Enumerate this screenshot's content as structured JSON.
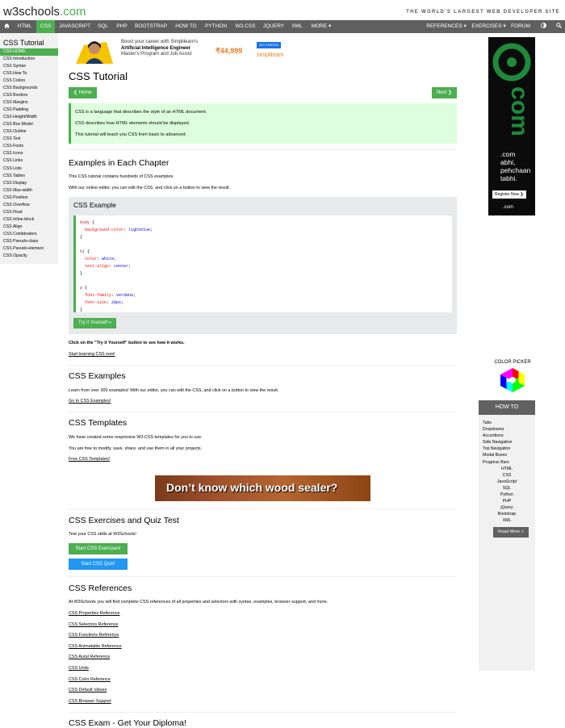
{
  "header": {
    "logo_text": "w3schools",
    "logo_suffix": ".com",
    "tagline": "THE WORLD'S LARGEST WEB DEVELOPER SITE"
  },
  "nav": {
    "items": [
      "HTML",
      "CSS",
      "JAVASCRIPT",
      "SQL",
      "PHP",
      "BOOTSTRAP",
      "HOW TO",
      "PYTHON",
      "W3.CSS",
      "JQUERY",
      "XML",
      "MORE ▾"
    ],
    "active": "CSS",
    "right_items": [
      "REFERENCES ▾",
      "EXERCISES ▾",
      "FORUM"
    ]
  },
  "sidebar": {
    "title": "CSS Tutorial",
    "links": [
      "CSS HOME",
      "CSS Introduction",
      "CSS Syntax",
      "CSS How To",
      "CSS Colors",
      "CSS Backgrounds",
      "CSS Borders",
      "CSS Margins",
      "CSS Padding",
      "CSS Height/Width",
      "CSS Box Model",
      "CSS Outline",
      "CSS Text",
      "CSS Fonts",
      "CSS Icons",
      "CSS Links",
      "CSS Lists",
      "CSS Tables",
      "CSS Display",
      "CSS Max-width",
      "CSS Position",
      "CSS Overflow",
      "CSS Float",
      "CSS Inline-block",
      "CSS Align",
      "CSS Combinators",
      "CSS Pseudo-class",
      "CSS Pseudo-element",
      "CSS Opacity"
    ]
  },
  "top_ad": {
    "line1": "Boost your career with Simplilearn's",
    "line2": "Artificial Intelligence Engineer",
    "line3": "Master's Program and Job Assist",
    "price": "₹44,999",
    "cta": "GET STARTED",
    "brand": "simplilearn"
  },
  "main": {
    "title": "CSS Tutorial",
    "home_button": "❮ Home",
    "next_button": "Next ❯",
    "intro": [
      "CSS is a language that describes the style of an HTML document.",
      "CSS describes how HTML elements should be displayed.",
      "This tutorial will teach you CSS from basic to advanced."
    ],
    "examples_heading": "Examples in Each Chapter",
    "examples_p1": "This CSS tutorial contains hundreds of CSS examples.",
    "examples_p2": "With our online editor, you can edit the CSS, and click on a button to view the result.",
    "example_box_title": "CSS Example",
    "code_lines": [
      {
        "sel": "body",
        "text": " {"
      },
      {
        "prop": "  background-color",
        "val": " lightblue;"
      },
      {
        "brc": "}"
      },
      {
        "sel": "h1",
        "text": " {"
      },
      {
        "prop": "  color",
        "val": " white;"
      },
      {
        "prop": "  text-align",
        "val": " center;"
      },
      {
        "brc": "}"
      },
      {
        "sel": "p",
        "text": " {"
      },
      {
        "prop": "  font-family",
        "val": " verdana;"
      },
      {
        "prop": "  font-size",
        "val": " 20px;"
      },
      {
        "brc": "}"
      }
    ],
    "try_button": "Try it Yourself »",
    "click_note": "Click on the \"Try it Yourself\" button to see how it works.",
    "start_learning_link": "Start learning CSS now!",
    "css_examples_heading": "CSS Examples",
    "css_examples_p": "Learn from over 300 examples! With our editor, you can edit the CSS, and click on a button to view the result.",
    "css_examples_link": "Go to CSS Examples!",
    "templates_heading": "CSS Templates",
    "templates_p1": "We have created some responsive W3.CSS templates for you to use.",
    "templates_p2": "You are free to modify, save, share, and use them in all your projects.",
    "templates_link": "Free CSS Templates!",
    "wood_ad": "Don’t know which wood sealer?",
    "exercises_heading": "CSS Exercises and Quiz Test",
    "exercises_p": "Test your CSS skills at W3Schools!",
    "exercises_button": "Start CSS Exercises!",
    "quiz_button": "Start CSS Quiz!",
    "references_heading": "CSS References",
    "references_p": "At W3Schools you will find complete CSS references of all properties and selectors with syntax, examples, browser support, and more.",
    "reference_links": [
      "CSS Properties Reference",
      "CSS Selectors Reference",
      "CSS Functions Reference",
      "CSS Animatable Reference",
      "CSS Aural Reference",
      "CSS Units",
      "CSS Color Reference",
      "CSS Default Values",
      "CSS Browser Support"
    ],
    "exam_heading": "CSS Exam - Get Your Diploma!"
  },
  "right": {
    "ad_lines": [
      ".com",
      "abhi,",
      "pehchaan",
      "tabhi.",
      "Register Now ❯",
      ".com"
    ],
    "color_picker": "COLOR PICKER",
    "howto_title": "HOW TO",
    "howto_links": [
      "Tabs",
      "Dropdowns",
      "Accordions",
      "Side Navigation",
      "Top Navigation",
      "Modal Boxes",
      "Progress Bars"
    ],
    "howto_centered": [
      "HTML",
      "CSS",
      "JavaScript",
      "SQL",
      "Python",
      "PHP",
      "jQuery",
      "Bootstrap",
      "XML"
    ],
    "read_more": "Read More »"
  },
  "colors": {
    "brand_green": "#4CAF50",
    "nav_gray": "#5f5f5f",
    "note_bg": "#ddffdd",
    "blue": "#2196F3"
  }
}
